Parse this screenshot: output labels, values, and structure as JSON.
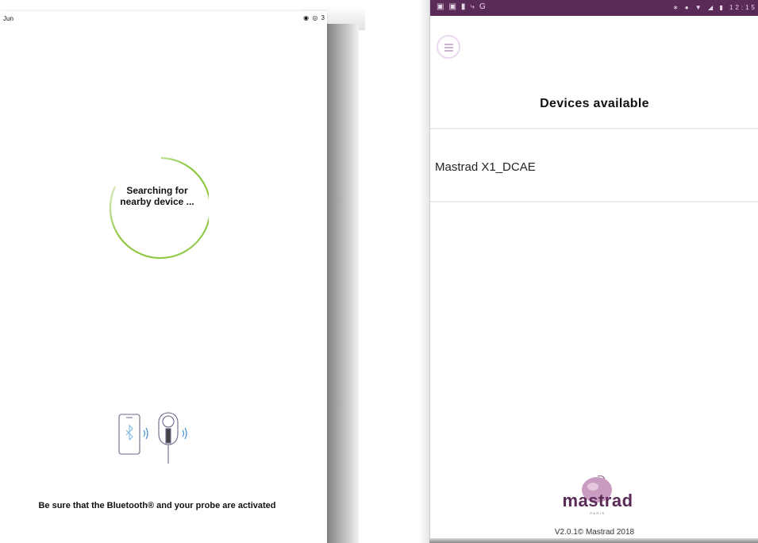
{
  "left_screen": {
    "status_bar": {
      "carrier": "Jun",
      "icons_text": "3"
    },
    "spinner": {
      "line1": "Searching for",
      "line2": "nearby device ..."
    },
    "footer_note": "Be sure that the Bluetooth® and your probe are activated",
    "colors": {
      "spinner_accent": "#8cc63f"
    }
  },
  "right_screen": {
    "status_bar": {
      "time": "12:15",
      "background": "#5b2b58"
    },
    "title": "Devices available",
    "devices": [
      {
        "name": "Mastrad X1_DCAE"
      }
    ],
    "logo": {
      "brand": "mastrad",
      "tagline": "PARIS"
    },
    "version": "V2.0.1© Mastrad 2018",
    "colors": {
      "brand_purple": "#5b2b58",
      "logo_plum": "#c99bc0"
    }
  }
}
